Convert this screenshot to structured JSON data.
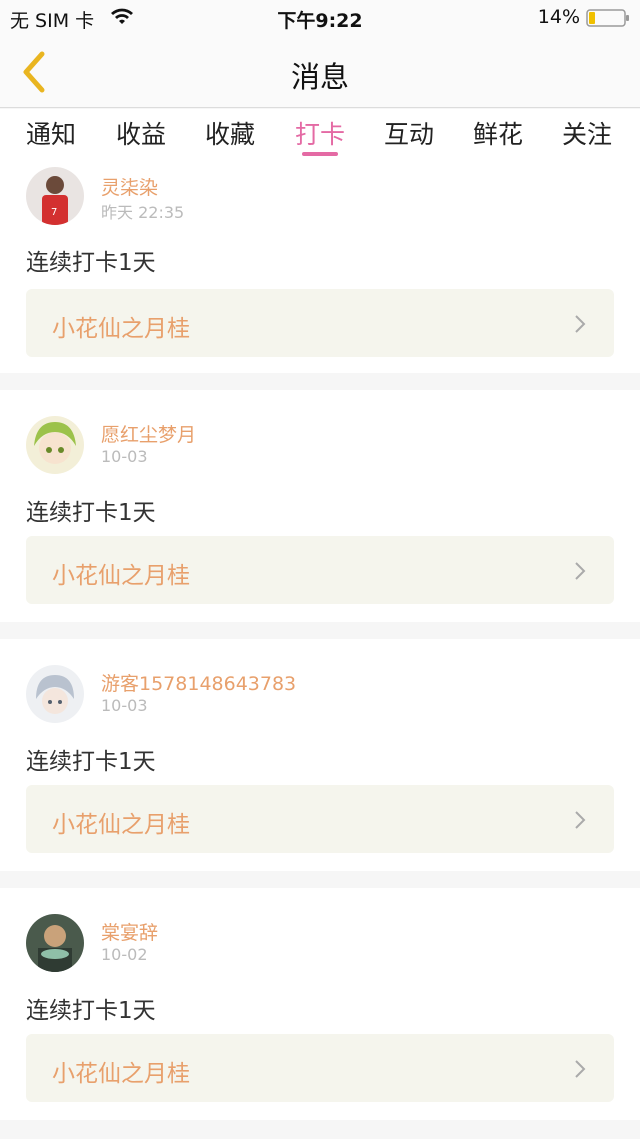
{
  "status_bar": {
    "carrier": "无 SIM 卡",
    "time": "下午9:22",
    "battery": "14%"
  },
  "nav": {
    "title": "消息"
  },
  "tabs": [
    {
      "label": "通知"
    },
    {
      "label": "收益"
    },
    {
      "label": "收藏"
    },
    {
      "label": "打卡",
      "active": true
    },
    {
      "label": "互动"
    },
    {
      "label": "鲜花"
    },
    {
      "label": "关注"
    }
  ],
  "colors": {
    "accent_pink": "#e46aa4",
    "name_orange": "#e8a06c",
    "link_bg": "#f5f5ed"
  },
  "feed": [
    {
      "name": "灵柒染",
      "time": "昨天 22:35",
      "text": "连续打卡1天",
      "link": "小花仙之月桂"
    },
    {
      "name": "愿红尘梦月",
      "time": "10-03",
      "text": "连续打卡1天",
      "link": "小花仙之月桂"
    },
    {
      "name": "游客1578148643783",
      "time": "10-03",
      "text": "连续打卡1天",
      "link": "小花仙之月桂"
    },
    {
      "name": "棠宴辞",
      "time": "10-02",
      "text": "连续打卡1天",
      "link": "小花仙之月桂"
    }
  ]
}
